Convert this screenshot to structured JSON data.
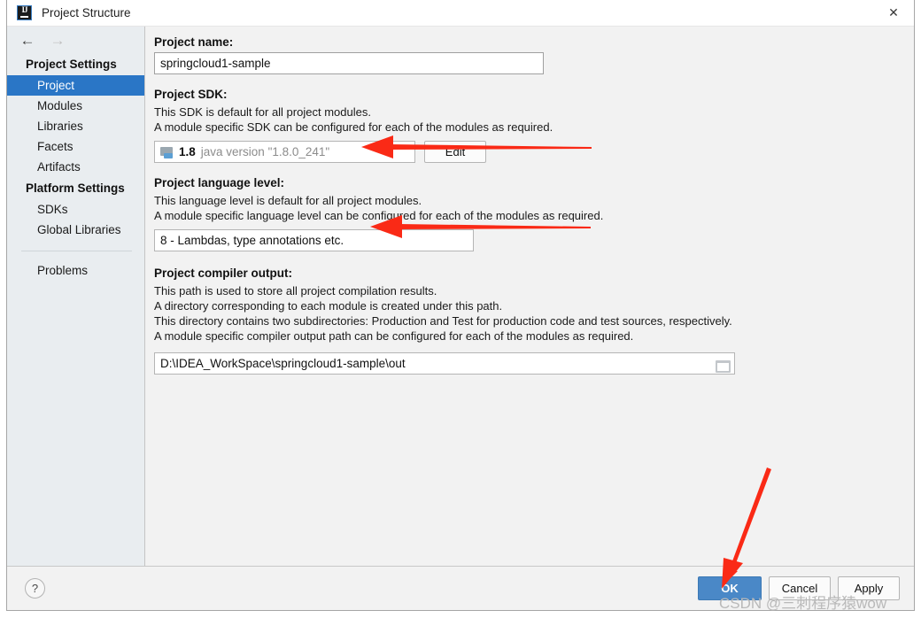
{
  "window": {
    "title": "Project Structure",
    "app_icon": "intellij-idea-icon",
    "close_icon": "close-icon"
  },
  "nav": {
    "back_icon": "arrow-left-icon",
    "forward_icon": "arrow-right-icon"
  },
  "sidebar": {
    "groups": [
      {
        "header": "Project Settings",
        "items": [
          {
            "label": "Project",
            "selected": true
          },
          {
            "label": "Modules",
            "selected": false
          },
          {
            "label": "Libraries",
            "selected": false
          },
          {
            "label": "Facets",
            "selected": false
          },
          {
            "label": "Artifacts",
            "selected": false
          }
        ]
      },
      {
        "header": "Platform Settings",
        "items": [
          {
            "label": "SDKs",
            "selected": false
          },
          {
            "label": "Global Libraries",
            "selected": false
          }
        ]
      }
    ],
    "problems": {
      "label": "Problems",
      "selected": false
    }
  },
  "main": {
    "project_name": {
      "label": "Project name:",
      "value": "springcloud1-sample",
      "placeholder": ""
    },
    "project_sdk": {
      "label": "Project SDK:",
      "descriptions": [
        "This SDK is default for all project modules.",
        "A module specific SDK can be configured for each of the modules as required."
      ],
      "icon": "sdk-folder-icon",
      "version": "1.8",
      "detail": "java version \"1.8.0_241\"",
      "edit_button": "Edit"
    },
    "language_level": {
      "label": "Project language level:",
      "descriptions": [
        "This language level is default for all project modules.",
        "A module specific language level can be configured for each of the modules as required."
      ],
      "value": "8 - Lambdas, type annotations etc."
    },
    "compiler_output": {
      "label": "Project compiler output:",
      "descriptions": [
        "This path is used to store all project compilation results.",
        "A directory corresponding to each module is created under this path.",
        "This directory contains two subdirectories: Production and Test for production code and test sources, respectively.",
        "A module specific compiler output path can be configured for each of the modules as required."
      ],
      "value": "D:\\IDEA_WorkSpace\\springcloud1-sample\\out",
      "browse_icon": "folder-browse-icon"
    }
  },
  "footer": {
    "help_label": "?",
    "ok_label": "OK",
    "cancel_label": "Cancel",
    "apply_label": "Apply"
  },
  "annotations": {
    "color": "#fa2a16",
    "arrow_sdk": "red-arrow-pointing-to-project-sdk",
    "arrow_language_level": "red-arrow-pointing-to-language-level",
    "arrow_ok": "red-arrow-pointing-to-ok-button"
  },
  "watermark": {
    "text": "CSDN @三刺程序猿wow"
  },
  "colors": {
    "selection_blue": "#2a76c6",
    "primary_button": "#4a88c7",
    "sidebar_bg": "#e9edf0",
    "dialog_bg": "#f2f2f2",
    "annotation_red": "#fa2a16"
  }
}
